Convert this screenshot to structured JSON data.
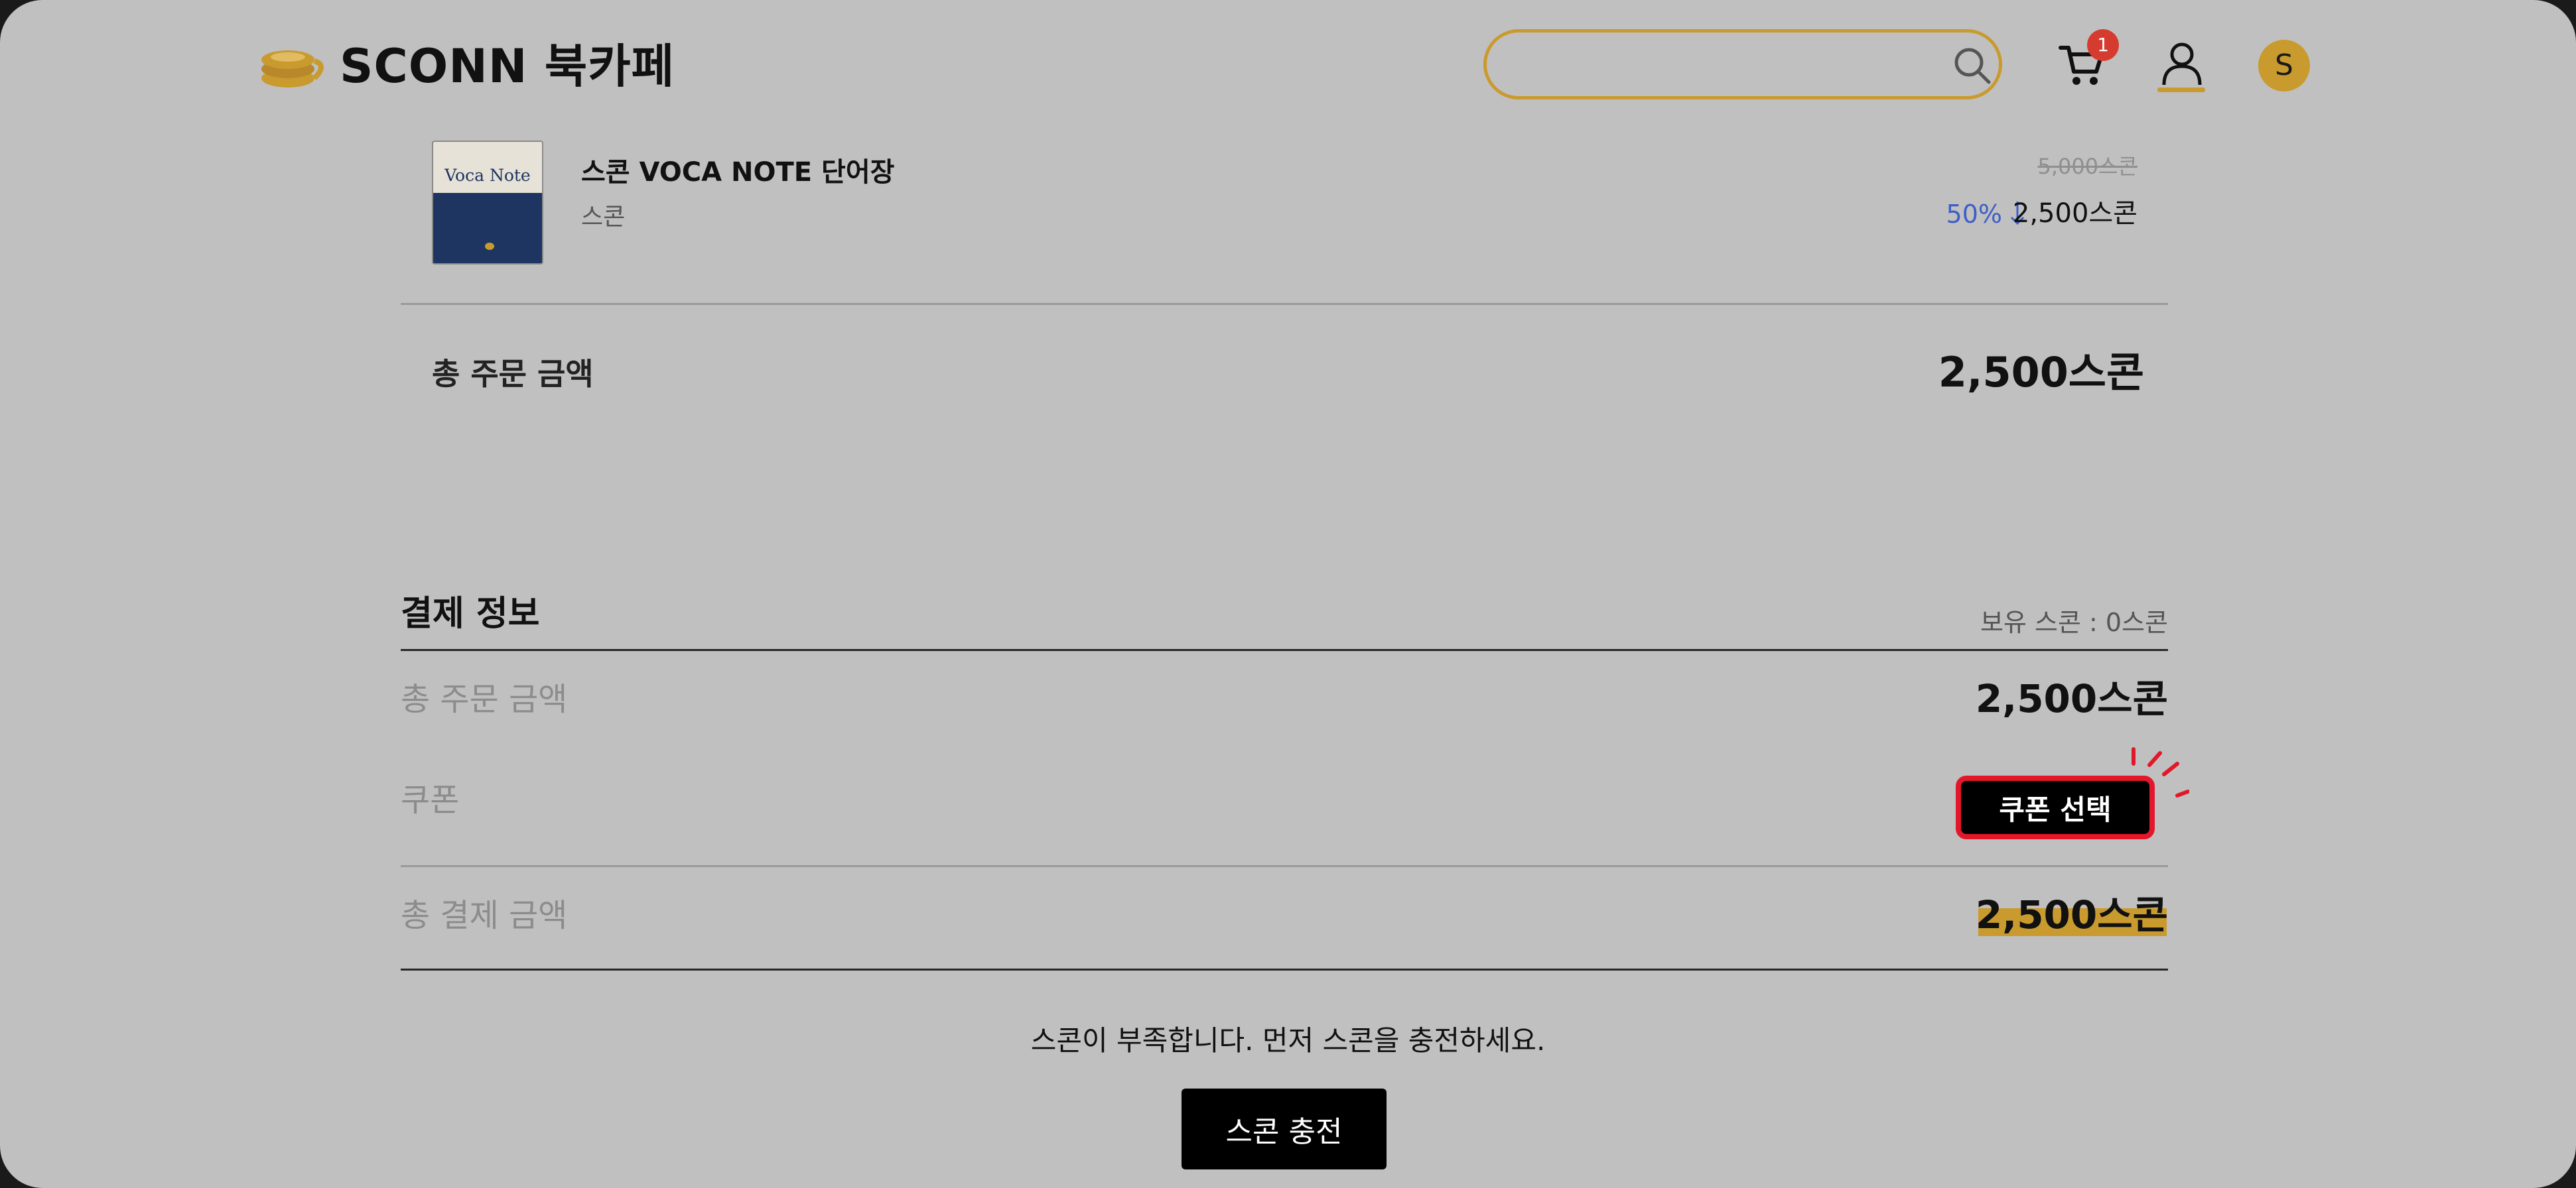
{
  "header": {
    "brand": "SCONN 북카페",
    "search": {
      "value": "",
      "placeholder": ""
    },
    "cart_badge": "1",
    "avatar_initial": "S",
    "accent_color": "#c99a2e"
  },
  "order_item": {
    "cover_title": "Voca Note",
    "name": "스콘 VOCA NOTE 단어장",
    "brand": "스콘",
    "original_price": "5,000스콘",
    "discount": "50%",
    "discount_icon": "arrow-down-icon",
    "sale_price": "2,500스콘"
  },
  "order_summary": {
    "total_label": "총 주문 금액",
    "total_value": "2,500스콘"
  },
  "payment": {
    "title": "결제 정보",
    "balance": "보유 스콘 : 0스콘",
    "order_total_label": "총 주문 금액",
    "order_total_value": "2,500스콘",
    "coupon_label": "쿠폰",
    "coupon_button": "쿠폰 선택",
    "payment_total_label": "총 결제 금액",
    "payment_total_value": "2,500스콘"
  },
  "notice": "스콘이 부족합니다. 먼저 스콘을 충전하세요.",
  "charge_button": "스콘 충전",
  "colors": {
    "discount": "#3f5fc8",
    "highlight": "#c99a2e",
    "coupon_border": "#e3172a"
  }
}
